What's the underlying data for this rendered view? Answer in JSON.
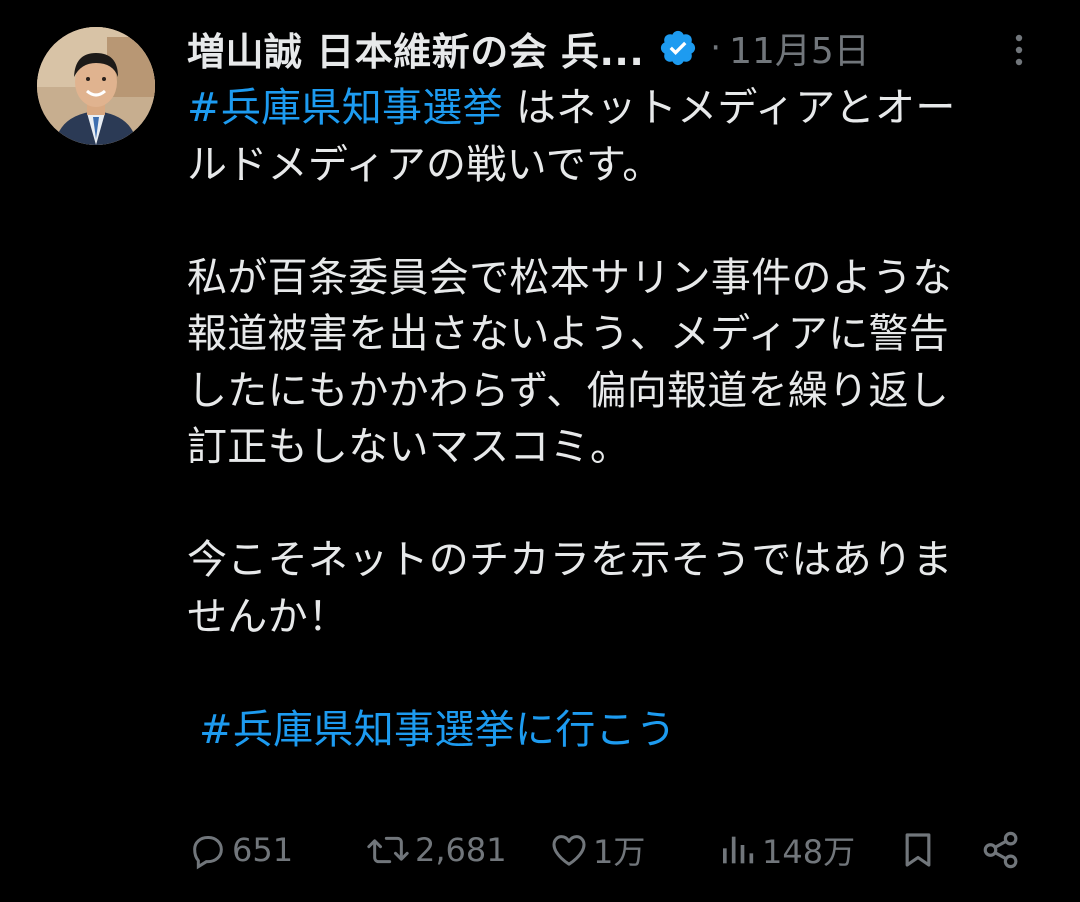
{
  "tweet": {
    "author_name": "増山誠 日本維新の会 兵...",
    "separator": "·",
    "date": "11月5日",
    "body": {
      "line1_hashtag": "#兵庫県知事選挙",
      "line1_rest": " はネットメディアとオー",
      "line2": "ルドメディアの戦いです。",
      "para2": [
        "私が百条委員会で松本サリン事件のような",
        "報道被害を出さないよう、メディアに警告",
        "したにもかかわらず、偏向報道を繰り返し",
        "訂正もしないマスコミ。"
      ],
      "para3": [
        "今こそネットのチカラを示そうではありま",
        "せんか！"
      ],
      "closing_hashtag": "#兵庫県知事選挙に行こう"
    },
    "actions": {
      "replies": "651",
      "retweets": "2,681",
      "likes": "1万",
      "views": "148万"
    }
  },
  "colors": {
    "background": "#000000",
    "text": "#e7e9ea",
    "muted": "#71767b",
    "link": "#1d9bf0"
  },
  "icons": [
    "avatar",
    "verified-badge-icon",
    "more-icon",
    "reply-icon",
    "retweet-icon",
    "like-icon",
    "views-icon",
    "bookmark-icon",
    "share-icon"
  ]
}
